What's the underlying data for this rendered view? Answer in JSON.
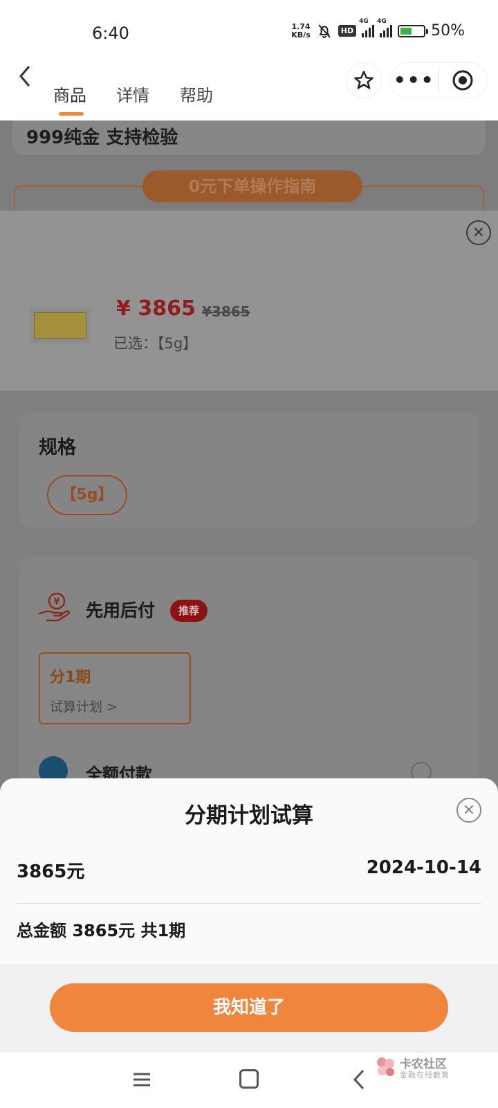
{
  "status_bar": {
    "time": "6:40",
    "net_speed_value": "1.74",
    "net_speed_unit": "KB/s",
    "hd_badge": "HD",
    "signal_1": "4G",
    "signal_2": "4G",
    "battery": "50%"
  },
  "nav": {
    "tabs": [
      {
        "label": "商品",
        "active": true
      },
      {
        "label": "详情",
        "active": false
      },
      {
        "label": "帮助",
        "active": false
      }
    ]
  },
  "background_page": {
    "title": "999纯金 支持检验",
    "guide_label": "0元下单操作指南"
  },
  "sku_sheet": {
    "price": "¥ 3865",
    "original_price": "¥3865",
    "selected_label": "已选：【5g】",
    "spec_title": "规格",
    "spec_options": [
      "【5g】"
    ],
    "payment": {
      "bnpl_title": "先用后付",
      "bnpl_badge": "推荐",
      "plan_label": "分1期",
      "plan_link": "试算计划 >",
      "full_title": "全额付款"
    }
  },
  "popup": {
    "title": "分期计划试算",
    "amount": "3865元",
    "date": "2024-10-14",
    "total": "总金额 3865元 共1期",
    "confirm_label": "我知道了"
  },
  "watermark": {
    "title": "卡农社区",
    "subtitle": "金融在线教育"
  },
  "colors": {
    "accent": "#f0853e",
    "price_red": "#e02020",
    "badge_red": "#d42a2a"
  }
}
